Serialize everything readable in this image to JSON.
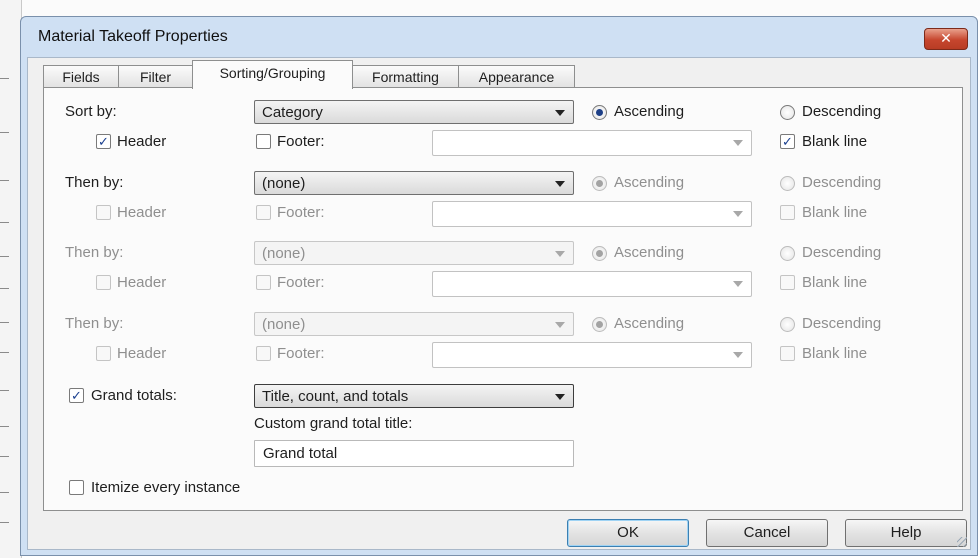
{
  "window": {
    "title": "Material Takeoff Properties",
    "close_glyph": "✕"
  },
  "tabs": [
    {
      "label": "Fields",
      "active": false
    },
    {
      "label": "Filter",
      "active": false
    },
    {
      "label": "Sorting/Grouping",
      "active": true
    },
    {
      "label": "Formatting",
      "active": false
    },
    {
      "label": "Appearance",
      "active": false
    }
  ],
  "sort_rows": [
    {
      "label": "Sort by:",
      "enabled": true,
      "value": "Category",
      "order": "Ascending",
      "header": true,
      "footer": false,
      "footer_value": "",
      "blank_line": true
    },
    {
      "label": "Then by:",
      "enabled": true,
      "value": "(none)",
      "order": "Ascending",
      "header": false,
      "footer": false,
      "footer_value": "",
      "blank_line": false
    },
    {
      "label": "Then by:",
      "enabled": false,
      "value": "(none)",
      "order": "Ascending",
      "header": false,
      "footer": false,
      "footer_value": "",
      "blank_line": false
    },
    {
      "label": "Then by:",
      "enabled": false,
      "value": "(none)",
      "order": "Ascending",
      "header": false,
      "footer": false,
      "footer_value": "",
      "blank_line": false
    }
  ],
  "row_labels": {
    "ascending": "Ascending",
    "descending": "Descending",
    "header": "Header",
    "footer": "Footer:",
    "blank_line": "Blank line"
  },
  "grand_totals": {
    "label": "Grand totals:",
    "checked": true,
    "value": "Title, count, and totals",
    "custom_title_label": "Custom grand total title:",
    "custom_title_value": "Grand total"
  },
  "itemize": {
    "label": "Itemize every instance",
    "checked": false
  },
  "buttons": {
    "ok": "OK",
    "cancel": "Cancel",
    "help": "Help"
  },
  "colors": {
    "title_bar": "#cfe0f3",
    "close_button": "#c6462e",
    "check_mark": "#1a3f8f",
    "disabled_text": "#8f8f8f"
  }
}
